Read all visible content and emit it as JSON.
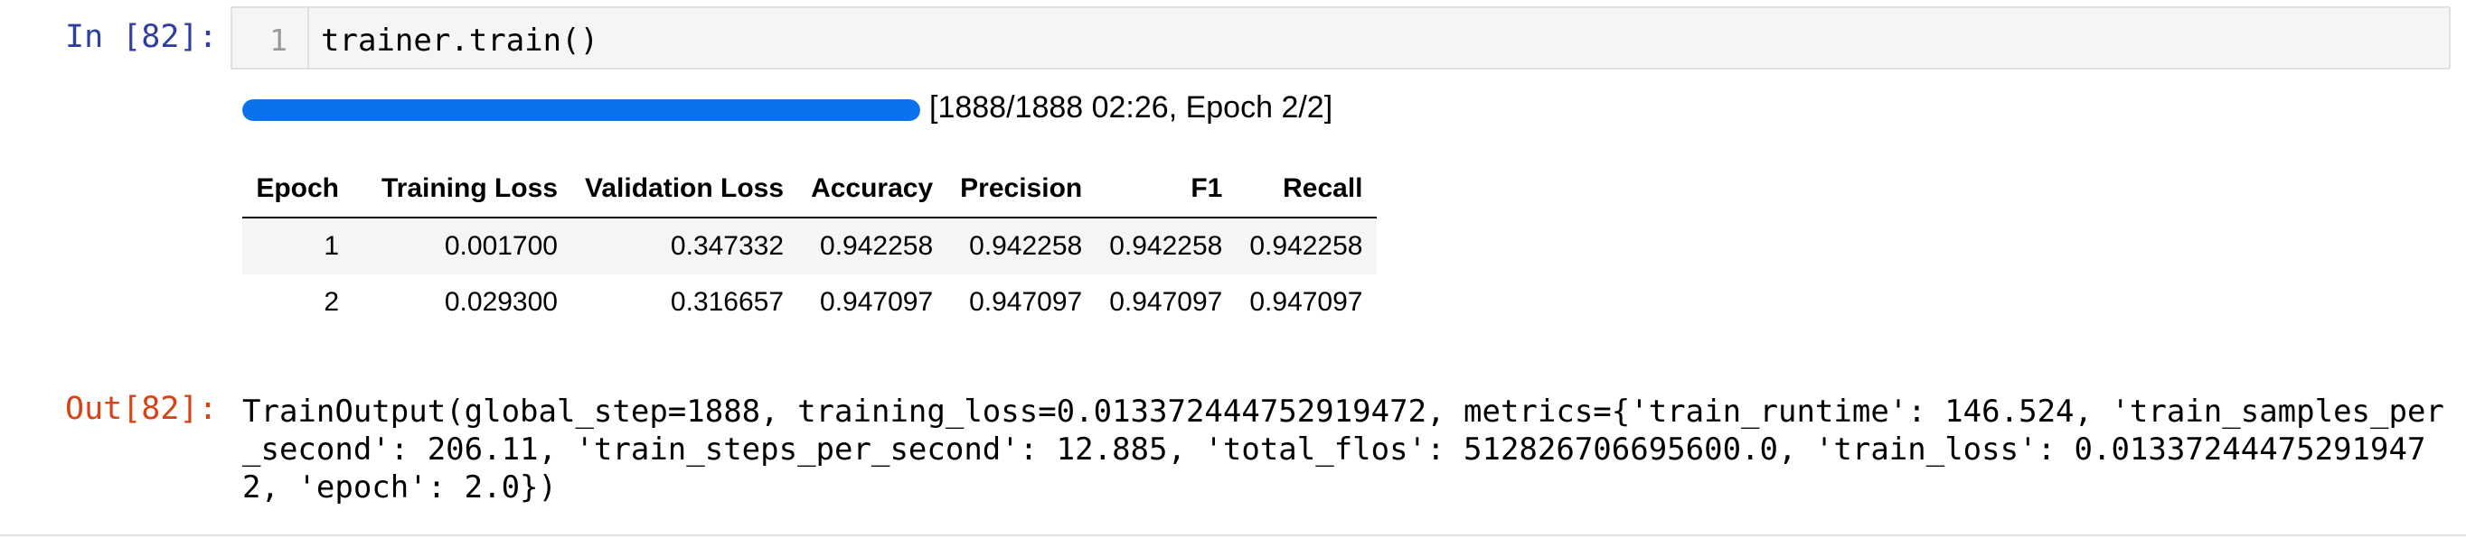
{
  "input_cell": {
    "prompt": "In [82]:",
    "line_number": "1",
    "code": "trainer.train()"
  },
  "progress": {
    "fraction": 1.0,
    "text": "[1888/1888 02:26, Epoch 2/2]",
    "bar_color": "#0a73eb"
  },
  "metrics_table": {
    "columns": [
      "Epoch",
      "Training Loss",
      "Validation Loss",
      "Accuracy",
      "Precision",
      "F1",
      "Recall"
    ],
    "rows": [
      [
        "1",
        "0.001700",
        "0.347332",
        "0.942258",
        "0.942258",
        "0.942258",
        "0.942258"
      ],
      [
        "2",
        "0.029300",
        "0.316657",
        "0.947097",
        "0.947097",
        "0.947097",
        "0.947097"
      ]
    ]
  },
  "output_cell": {
    "prompt": "Out[82]:",
    "text": "TrainOutput(global_step=1888, training_loss=0.013372444752919472, metrics={'train_runtime': 146.524, 'train_samples_per_second': 206.11, 'train_steps_per_second': 12.885, 'total_flos': 512826706695600.0, 'train_loss': 0.013372444752919472, 'epoch': 2.0})"
  },
  "colors": {
    "in_prompt": "#303f9f",
    "out_prompt": "#d84315"
  }
}
